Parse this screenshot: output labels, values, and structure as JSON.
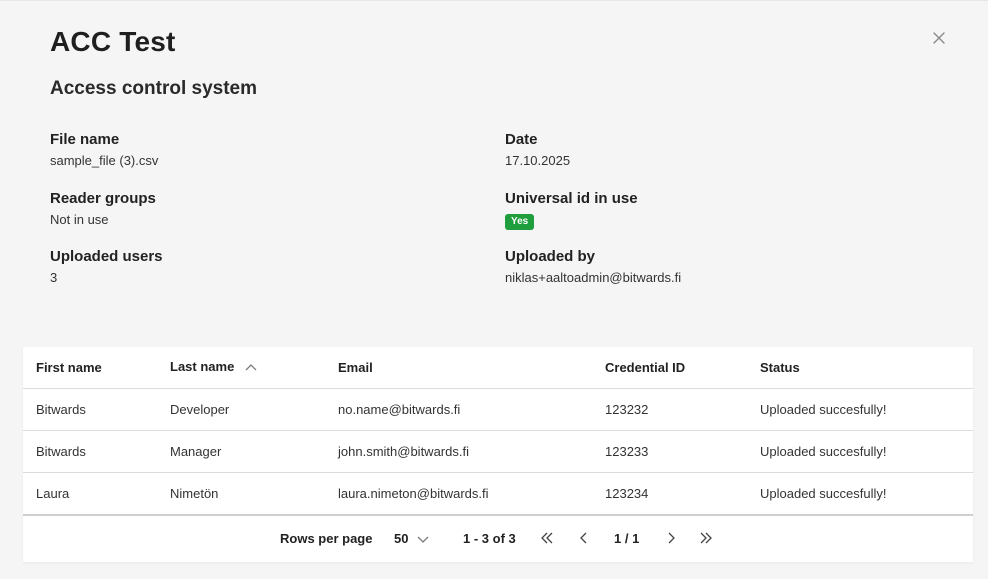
{
  "header": {
    "title": "ACC Test",
    "subtitle": "Access control system"
  },
  "details": {
    "file_name": {
      "label": "File name",
      "value": "sample_file (3).csv"
    },
    "date": {
      "label": "Date",
      "value": "17.10.2025"
    },
    "reader_groups": {
      "label": "Reader groups",
      "value": "Not in use"
    },
    "universal_id": {
      "label": "Universal id in use",
      "badge": "Yes",
      "badge_color": "#1e9e3c"
    },
    "uploaded_users": {
      "label": "Uploaded users",
      "value": "3"
    },
    "uploaded_by": {
      "label": "Uploaded by",
      "value": "niklas+aaltoadmin@bitwards.fi"
    }
  },
  "table": {
    "columns": [
      "First name",
      "Last name",
      "Email",
      "Credential ID",
      "Status"
    ],
    "sort_column": "Last name",
    "rows": [
      [
        "Bitwards",
        "Developer",
        "no.name@bitwards.fi",
        "123232",
        "Uploaded succesfully!"
      ],
      [
        "Bitwards",
        "Manager",
        "john.smith@bitwards.fi",
        "123233",
        "Uploaded succesfully!"
      ],
      [
        "Laura",
        "Nimetön",
        "laura.nimeton@bitwards.fi",
        "123234",
        "Uploaded succesfully!"
      ]
    ]
  },
  "pagination": {
    "rows_per_page_label": "Rows per page",
    "rows_per_page_value": "50",
    "range": "1 - 3 of 3",
    "page": "1 / 1"
  },
  "icons": {
    "close": "close-icon",
    "sort": "chevron-up-icon",
    "dropdown": "chevron-down-icon",
    "first": "double-chevron-left-icon",
    "prev": "chevron-left-icon",
    "next": "chevron-right-icon",
    "last": "double-chevron-right-icon"
  }
}
